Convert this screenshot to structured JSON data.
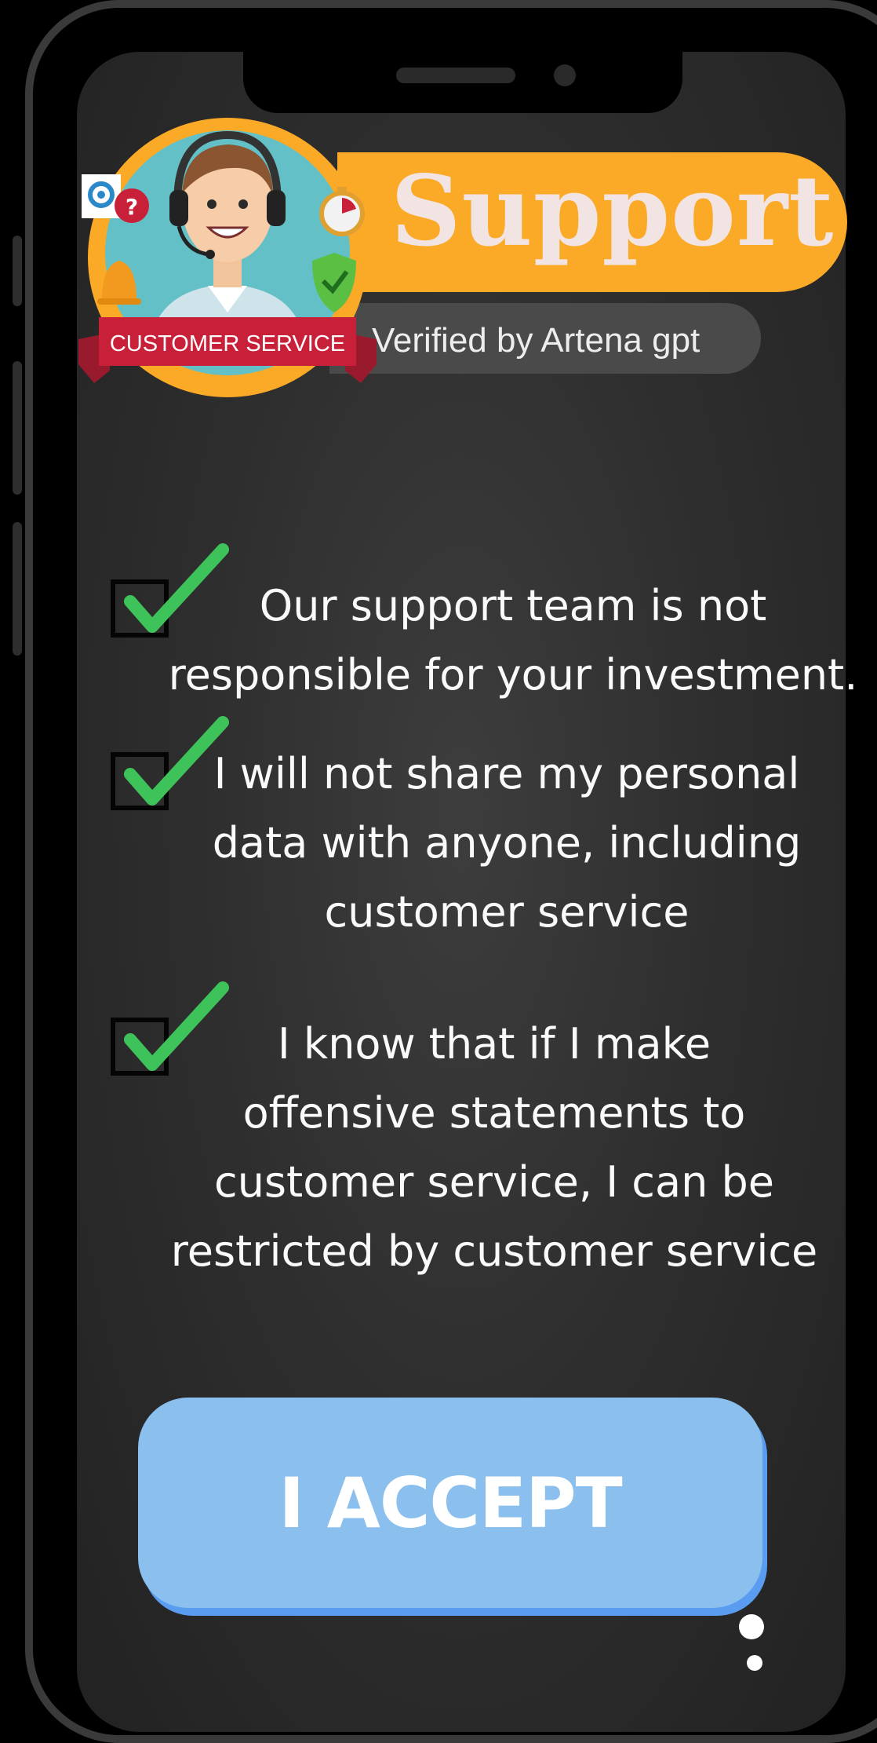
{
  "header": {
    "title": "Support",
    "subtitle": "Verified by Artena gpt"
  },
  "badge": {
    "banner_text": "CUSTOMER SERVICE",
    "icons": [
      "gear-icon",
      "question-icon",
      "bell-icon",
      "stopwatch-icon",
      "shield-check-icon",
      "headset-agent-avatar"
    ]
  },
  "terms": [
    {
      "text": "Our support team is not\nresponsible for your investment.",
      "checked": true
    },
    {
      "text": "I will not share my personal\ndata with anyone, including\ncustomer service",
      "checked": true
    },
    {
      "text": "I know that if I make\noffensive statements to\ncustomer service, I can be\nrestricted by customer service",
      "checked": true
    }
  ],
  "accept_button": {
    "label": "I ACCEPT"
  },
  "colors": {
    "title_pill": "#fbaa28",
    "check_green": "#3ec35a",
    "accept_button": "#8abfee",
    "banner_red": "#c9203a"
  }
}
